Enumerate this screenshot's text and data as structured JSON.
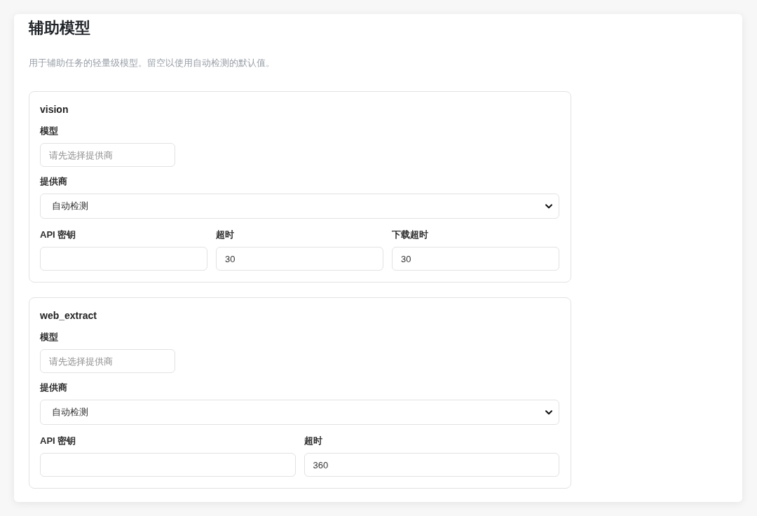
{
  "section": {
    "title": "辅助模型",
    "description": "用于辅助任务的轻量级模型。留空以使用自动检测的默认值。"
  },
  "tasks": [
    {
      "name": "vision",
      "model": {
        "label": "模型",
        "placeholder": "请先选择提供商"
      },
      "provider": {
        "label": "提供商",
        "value": "自动检测"
      },
      "settings": [
        {
          "label": "API 密钥"
        },
        {
          "label": "超时",
          "value": "30"
        },
        {
          "label": "下载超时",
          "value": "30"
        }
      ]
    },
    {
      "name": "web_extract",
      "model": {
        "label": "模型",
        "placeholder": "请先选择提供商"
      },
      "provider": {
        "label": "提供商",
        "value": "自动检测"
      },
      "settings": [
        {
          "label": "API 密钥"
        },
        {
          "label": "超时",
          "value": "360"
        }
      ]
    }
  ]
}
